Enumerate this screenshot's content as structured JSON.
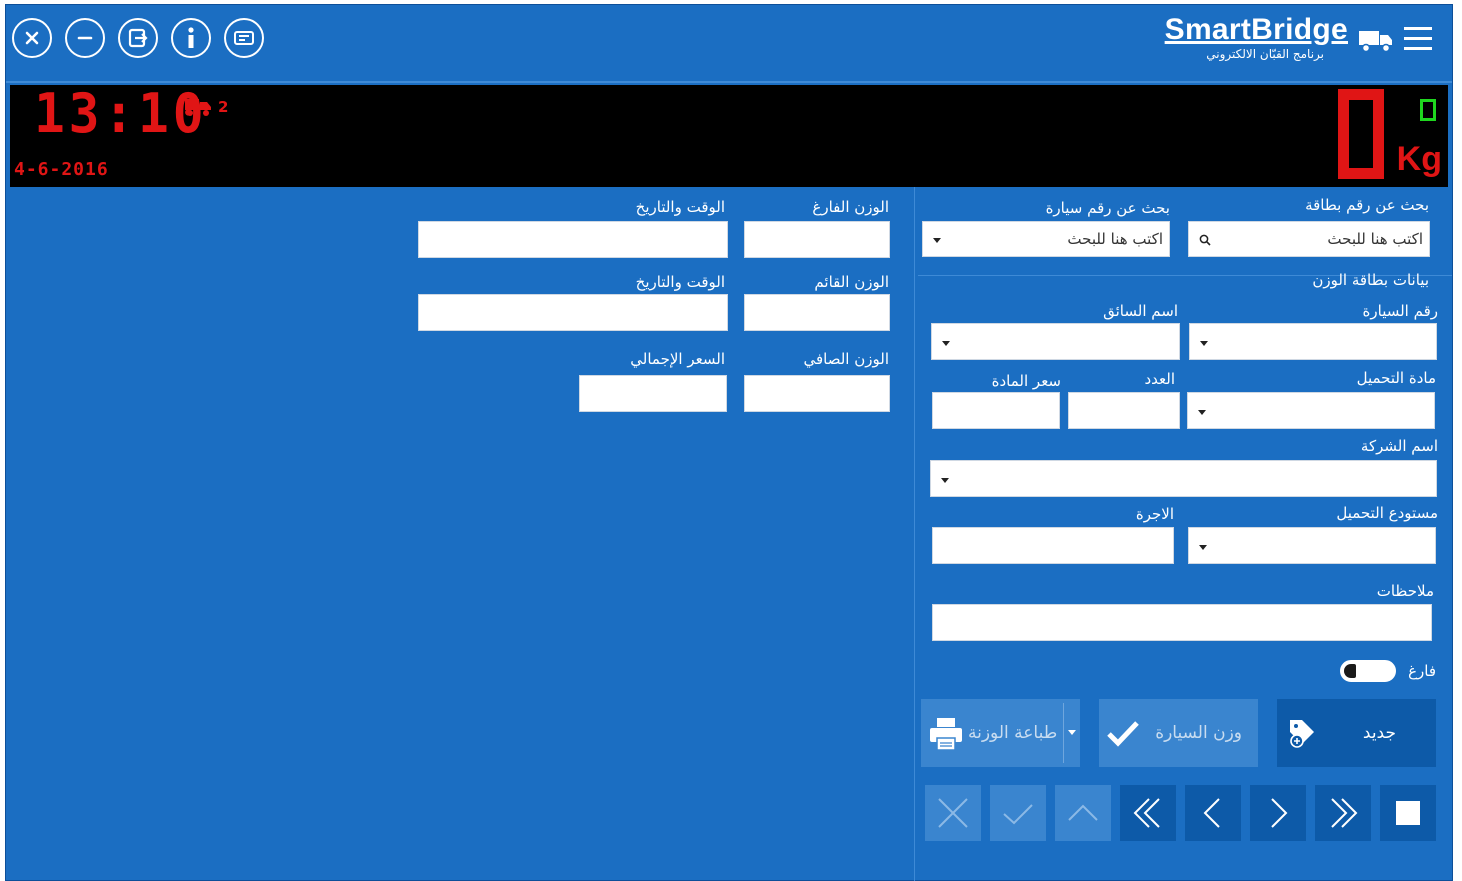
{
  "brand": {
    "name": "SmartBridge",
    "subtitle": "برنامج القبّان الالكتروني"
  },
  "display": {
    "time": "13:10",
    "date": "4-6-2016",
    "car_count": "2",
    "weight": "0",
    "unit": "Kg"
  },
  "search": {
    "card_label": "بحث عن رقم بطاقة",
    "card_placeholder": "اكتب هنا للبحث",
    "car_label": "بحث عن رقم سيارة",
    "car_placeholder": "اكتب هنا للبحث"
  },
  "weights": {
    "empty_label": "الوزن الفارغ",
    "empty_time_label": "الوقت والتاريخ",
    "full_label": "الوزن القائم",
    "full_time_label": "الوقت والتاريخ",
    "net_label": "الوزن الصافي",
    "total_price_label": "السعر الإجمالي"
  },
  "card": {
    "section_title": "بيانات بطاقة الوزن",
    "car_number_label": "رقم السيارة",
    "driver_name_label": "اسم السائق",
    "material_label": "مادة التحميل",
    "count_label": "العدد",
    "material_price_label": "سعر المادة",
    "company_label": "اسم الشركة",
    "warehouse_label": "مستودع التحميل",
    "fare_label": "الاجرة",
    "notes_label": "ملاحظات",
    "empty_toggle_label": "فارغ"
  },
  "actions": {
    "new_label": "جديد",
    "weigh_label": "وزن السيارة",
    "print_label": "طباعة الوزنة"
  },
  "colors": {
    "background": "#1b6ec2",
    "dark_button": "#0d5aa8",
    "disabled_button": "#3a85cf",
    "led_red": "#e01515",
    "led_green": "#1fd61f"
  }
}
